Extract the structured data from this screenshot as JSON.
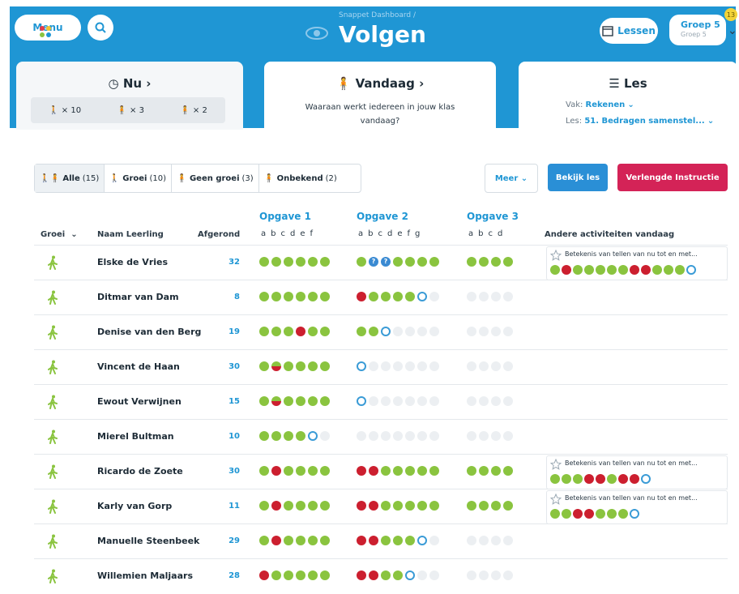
{
  "header": {
    "menu_label": "Menu",
    "breadcrumb": "Snappet Dashboard /",
    "title": "Volgen",
    "lessen_label": "Lessen",
    "groep_label": "Groep 5",
    "groep_sub": "Groep 5",
    "badge": "13",
    "accent_color": "#1f96d4"
  },
  "cards": {
    "nu": {
      "title": "Nu ›",
      "growth": "× 10",
      "no_growth": "× 3",
      "unknown": "× 2"
    },
    "vandaag": {
      "title": "Vandaag ›",
      "text": "Waaraan werkt iedereen in jouw klas vandaag?"
    },
    "les": {
      "title": "Les",
      "vak_label": "Vak:",
      "vak_value": "Rekenen",
      "les_label": "Les:",
      "les_value": "51. Bedragen samenstel..."
    }
  },
  "filters": {
    "alle": "Alle",
    "alle_count": "(15)",
    "groei": "Groei",
    "groei_count": "(10)",
    "geen_groei": "Geen groei",
    "geen_groei_count": "(3)",
    "onbekend": "Onbekend",
    "onbekend_count": "(2)"
  },
  "actions": {
    "meer": "Meer",
    "bekijk": "Bekijk les",
    "instructie": "Verlengde Instructie"
  },
  "table": {
    "col_groei": "Groei",
    "col_naam": "Naam Leerling",
    "col_afgerond": "Afgerond",
    "col_andere": "Andere activiteiten vandaag",
    "opgave1": "Opgave 1",
    "opgave1_letters": "abcdef",
    "opgave2": "Opgave 2",
    "opgave2_letters": "abcdefg",
    "opgave3": "Opgave 3",
    "opgave3_letters": "abcd",
    "activity_title": "Betekenis van tellen van nu tot en met...",
    "rows": [
      {
        "name": "Elske de Vries",
        "score": "32",
        "o1": "gggggg",
        "o2": "gqqgggg",
        "o3": "gggg",
        "activity": "grgggggrrgggo"
      },
      {
        "name": "Ditmar van Dam",
        "score": "8",
        "o1": "gggggg",
        "o2": "rggggoe",
        "o3": "eeee",
        "activity": ""
      },
      {
        "name": "Denise van den Berg",
        "score": "19",
        "o1": "gggrgg",
        "o2": "ggoeeee",
        "o3": "eeee",
        "activity": ""
      },
      {
        "name": "Vincent de Haan",
        "score": "30",
        "o1": "ghgggg",
        "o2": "oeeeeee",
        "o3": "eeee",
        "activity": ""
      },
      {
        "name": "Ewout Verwijnen",
        "score": "15",
        "o1": "ghgggg",
        "o2": "oeeeeee",
        "o3": "eeee",
        "activity": ""
      },
      {
        "name": "Mierel Bultman",
        "score": "10",
        "o1": "ggggoe",
        "o2": "eeeeeee",
        "o3": "eeee",
        "activity": ""
      },
      {
        "name": "Ricardo de Zoete",
        "score": "30",
        "o1": "grgggg",
        "o2": "rrggggg",
        "o3": "gggg",
        "activity": "gggrrgrro"
      },
      {
        "name": "Karly van Gorp",
        "score": "11",
        "o1": "grgggg",
        "o2": "rrggggg",
        "o3": "gggg",
        "activity": "ggrrgggo"
      },
      {
        "name": "Manuelle Steenbeek",
        "score": "29",
        "o1": "grgggg",
        "o2": "rrgggoe",
        "o3": "eeee",
        "activity": ""
      },
      {
        "name": "Willemien Maljaars",
        "score": "28",
        "o1": "rggggg",
        "o2": "rrggoee",
        "o3": "eeee",
        "activity": ""
      }
    ]
  }
}
